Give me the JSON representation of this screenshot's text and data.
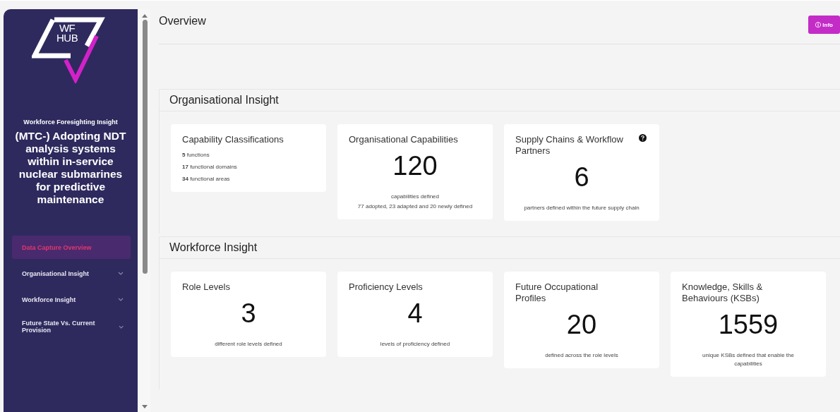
{
  "sidebar": {
    "logo": {
      "line_1": "WF",
      "line_2": "HUB"
    },
    "subtitle": "Workforce Foresighting Insight",
    "project_title": "(MTC-) Adopting NDT analysis systems within in-service nuclear submarines for predictive maintenance",
    "items": [
      {
        "label": "Data Capture Overview",
        "selected": true,
        "expandable": false
      },
      {
        "label": "Organisational Insight",
        "selected": false,
        "expandable": true
      },
      {
        "label": "Workforce Insight",
        "selected": false,
        "expandable": true
      },
      {
        "label": "Future State Vs. Current Provision",
        "selected": false,
        "expandable": true
      }
    ]
  },
  "page": {
    "title": "Overview",
    "info_button": "ⓘ Info"
  },
  "sections": [
    {
      "title": "Organisational Insight",
      "cards": [
        {
          "kind": "list",
          "title": "Capability Classifications",
          "lines": [
            "**5** functions",
            "**17** functional domains",
            "**34** functional areas"
          ],
          "help": false
        },
        {
          "kind": "stat",
          "title": "Organisational Capabilities",
          "value": "120",
          "lines": [
            "capabilities defined",
            "77 adopted, 23 adapted and 20 newly defined"
          ],
          "help": false
        },
        {
          "kind": "stat",
          "title": "Supply Chains & Workflow Partners",
          "value": "6",
          "lines": [
            "partners defined within the future supply chain"
          ],
          "help": true
        }
      ]
    },
    {
      "title": "Workforce Insight",
      "cards": [
        {
          "kind": "stat",
          "title": "Role Levels",
          "value": "3",
          "lines": [
            "different role levels defined"
          ],
          "help": false
        },
        {
          "kind": "stat",
          "title": "Proficiency Levels",
          "value": "4",
          "lines": [
            "levels of proficiency defined"
          ],
          "help": false
        },
        {
          "kind": "stat",
          "title": "Future Occupational Profiles",
          "value": "20",
          "lines": [
            "defined across the role levels"
          ],
          "help": false
        },
        {
          "kind": "stat",
          "title": "Knowledge, Skills & Behaviours (KSBs)",
          "value": "1559",
          "lines": [
            "unique KSBs defined that enable the capabilities"
          ],
          "help": false
        }
      ]
    }
  ]
}
